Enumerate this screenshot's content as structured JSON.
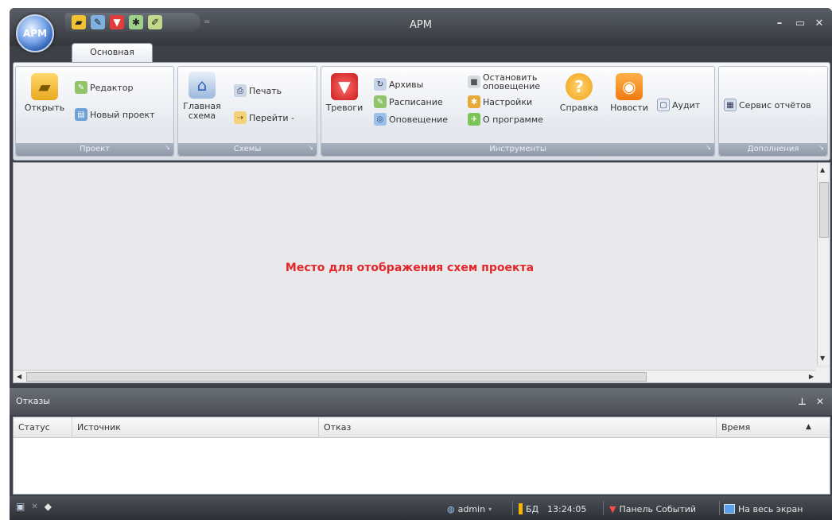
{
  "window": {
    "title": "АРМ",
    "app_orb_label": "АРМ"
  },
  "quick_access": [
    {
      "icon": "open-folder-icon"
    },
    {
      "icon": "editor-icon"
    },
    {
      "icon": "alarms-icon"
    },
    {
      "icon": "settings-icon"
    },
    {
      "icon": "edit-pencil-icon"
    }
  ],
  "tabs": {
    "main": "Основная"
  },
  "ribbon": {
    "project": {
      "label": "Проект",
      "open": "Открыть",
      "editor": "Редактор",
      "new_project": "Новый проект"
    },
    "schemes": {
      "label": "Схемы",
      "main_scheme_line1": "Главная",
      "main_scheme_line2": "схема",
      "print": "Печать",
      "goto": "Перейти -"
    },
    "tools": {
      "label": "Инструменты",
      "alarms": "Тревоги",
      "archives": "Архивы",
      "schedule": "Расписание",
      "notification": "Оповещение",
      "stop_line1": "Остановить",
      "stop_line2": "оповещение",
      "settings": "Настройки",
      "about": "О программе",
      "help": "Справка",
      "news": "Новости",
      "audit": "Аудит"
    },
    "addons": {
      "label": "Дополнения",
      "report_service": "Сервис отчётов"
    }
  },
  "canvas": {
    "placeholder": "Место для отображения схем проекта"
  },
  "failures_panel": {
    "title": "Отказы",
    "columns": [
      "Статус",
      "Источник",
      "Отказ",
      "Время"
    ]
  },
  "statusbar": {
    "user": "admin",
    "db_label": "БД",
    "time": "13:24:05",
    "events_panel": "Панель Событий",
    "fullscreen": "На весь экран"
  },
  "colors": {
    "placeholder_text": "#e3262a",
    "window_frame": "#3d4147"
  }
}
